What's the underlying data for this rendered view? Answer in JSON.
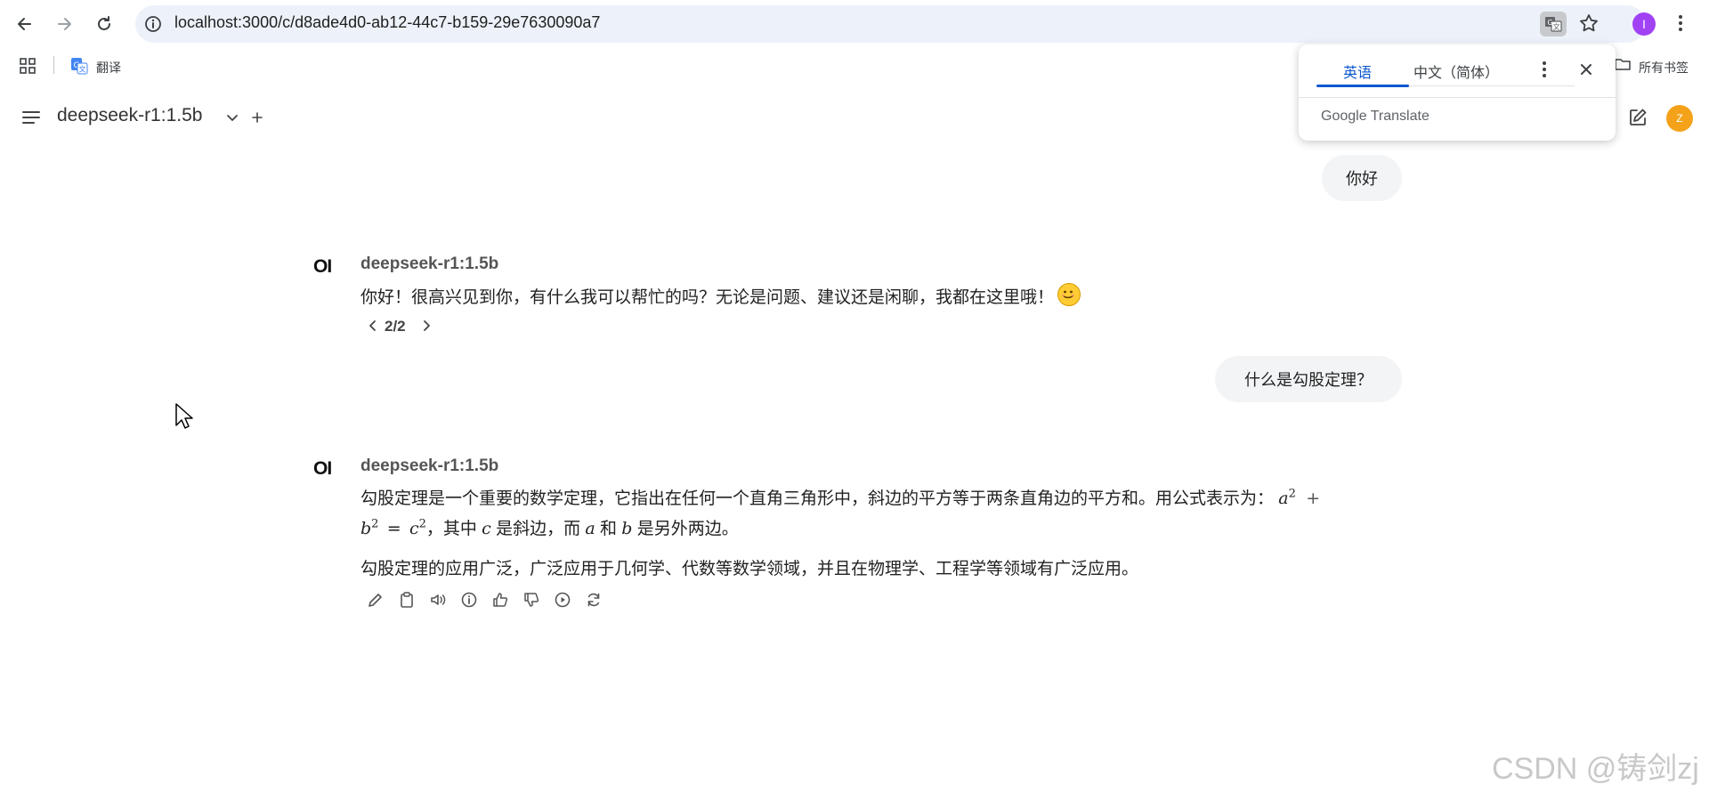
{
  "browser": {
    "url": "localhost:3000/c/d8ade4d0-ab12-44c7-b159-29e7630090a7",
    "profile_initial": "I",
    "bookmarks": {
      "translate_label": "翻译",
      "all_bookmarks_label": "所有书签"
    }
  },
  "translate_popup": {
    "source_lang": "英语",
    "target_lang": "中文（简体）",
    "brand": "Google Translate"
  },
  "app": {
    "model_name": "deepseek-r1:1.5b",
    "user_initial": "Z"
  },
  "chat": {
    "bot_logo": "OI",
    "messages": [
      {
        "role": "user",
        "text": "你好"
      },
      {
        "role": "assistant",
        "name": "deepseek-r1:1.5b",
        "text": "你好！很高兴见到你，有什么我可以帮忙的吗？无论是问题、建议还是闲聊，我都在这里哦！",
        "pager": "2/2"
      },
      {
        "role": "user",
        "text": "什么是勾股定理？"
      },
      {
        "role": "assistant",
        "name": "deepseek-r1:1.5b",
        "line1_text": "勾股定理是一个重要的数学定理，它指出在任何一个直角三角形中，斜边的平方等于两条直角边的平方和。用公式表示为：",
        "line2_a": "，其中 ",
        "line2_b": " 是斜边，而 ",
        "line2_c": " 和 ",
        "line2_d": " 是另外两边。",
        "paragraph2": "勾股定理的应用广泛，广泛应用于几何学、代数等数学领域，并且在物理学、工程学等领域有广泛应用。",
        "math": {
          "a": "a",
          "b": "b",
          "c": "c",
          "exp": "2",
          "plus": "+",
          "eq": "="
        }
      }
    ]
  },
  "watermark": "CSDN @铸剑zj"
}
